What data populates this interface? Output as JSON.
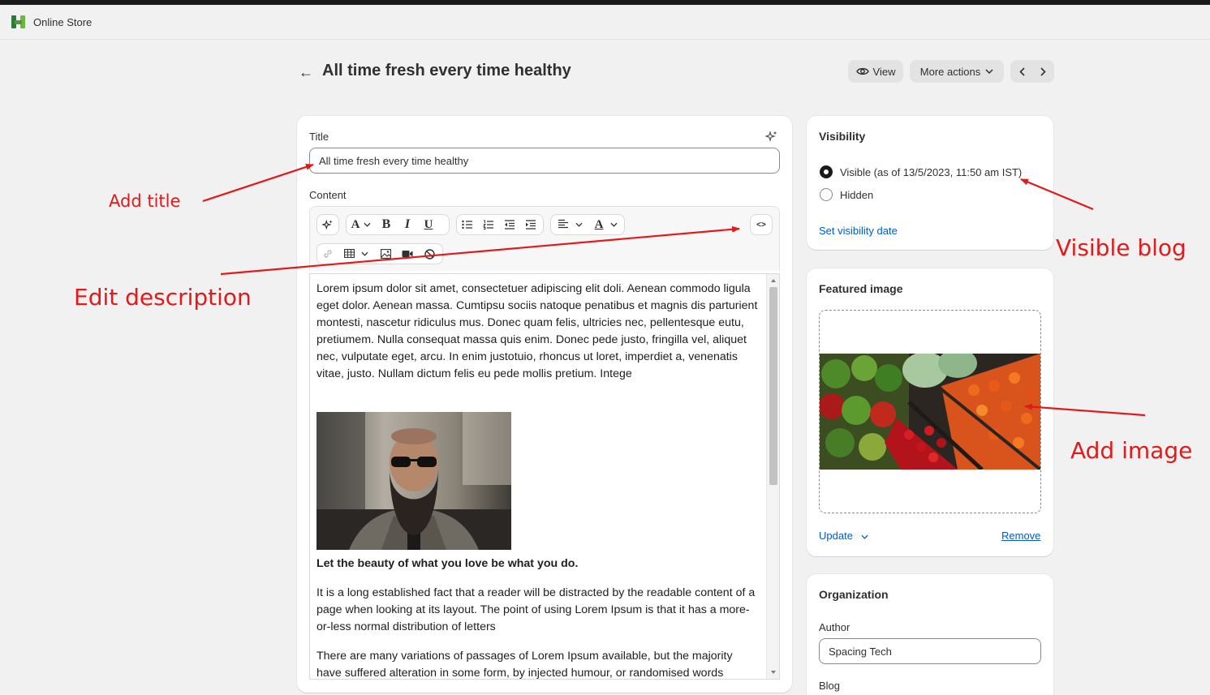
{
  "app": {
    "title": "Online Store"
  },
  "header": {
    "back_label": "←",
    "title": "All time fresh every time healthy",
    "view_label": "View",
    "more_actions_label": "More actions"
  },
  "post": {
    "title_label": "Title",
    "title_value": "All time fresh every time healthy",
    "content_label": "Content",
    "paragraph1": "Lorem ipsum dolor sit amet, consectetuer adipiscing elit doli. Aenean commodo ligula eget dolor. Aenean massa. Cumtipsu sociis natoque penatibus et magnis dis parturient montesti, nascetur ridiculus mus. Donec quam felis, ultricies nec, pellentesque eutu, pretiumem. Nulla consequat massa quis enim. Donec pede justo, fringilla vel, aliquet nec, vulputate eget, arcu. In enim justotuio, rhoncus ut loret, imperdiet a, venenatis vitae, justo. Nullam dictum felis eu pede mollis pretium. Intege",
    "heading": "Let the beauty of what you love be what you do.",
    "paragraph2": "It is a long established fact that a reader will be distracted by the readable content of a page when looking at its layout. The point of using Lorem Ipsum is that it has a more-or-less normal distribution of letters",
    "paragraph3": "There are many variations of passages of Lorem Ipsum available, but the majority have suffered alteration in some form, by injected humour, or randomised words"
  },
  "toolbar": {
    "font_label": "A",
    "bold_label": "B",
    "italic_label": "I",
    "underline_label": "U",
    "color_label": "A",
    "html_label": "<>"
  },
  "visibility": {
    "title": "Visibility",
    "visible_label": "Visible (as of 13/5/2023, 11:50 am IST)",
    "hidden_label": "Hidden",
    "selected": "visible",
    "set_date_label": "Set visibility date"
  },
  "featured_image": {
    "title": "Featured image",
    "update_label": "Update",
    "remove_label": "Remove"
  },
  "organization": {
    "title": "Organization",
    "author_label": "Author",
    "author_value": "Spacing Tech",
    "blog_label": "Blog"
  },
  "annotations": {
    "add_title": "Add title",
    "edit_description": "Edit description",
    "visible_blog": "Visible blog",
    "add_image": "Add image"
  },
  "colors": {
    "annotation": "#e11b1b",
    "link": "#005bd3",
    "selected_radio": "#1a1a1a"
  }
}
